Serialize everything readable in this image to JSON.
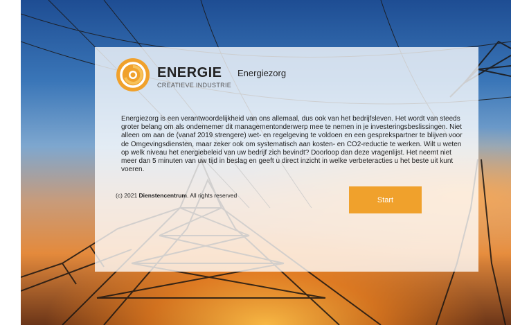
{
  "brand": {
    "name": "ENERGIE",
    "subtitle": "CREATIEVE INDUSTRIE",
    "icon": "energy-swirl-icon",
    "accent": "#f0a12c"
  },
  "header": {
    "title": "Energiezorg"
  },
  "intro": {
    "text": "Energiezorg is een verantwoordelijkheid van ons allemaal, dus ook van het bedrijfsleven. Het wordt van steeds groter belang om als ondernemer dit managementonderwerp mee te nemen in je investeringsbeslissingen. Niet alleen om aan de (vanaf 2019 strengere) wet- en regelgeving te voldoen en een gesprekspartner te blijven voor de Omgevingsdiensten, maar zeker ook om systematisch aan kosten- en CO2-reductie te werken. Wilt u weten op welk niveau het energiebeleid van uw bedrijf zich bevindt? Doorloop dan deze vragenlijst. Het neemt niet meer dan 5 minuten van uw tijd in beslag en geeft u direct inzicht in welke verbeteracties u het beste uit kunt voeren."
  },
  "footer": {
    "copyright_prefix": "(c) 2021 ",
    "copyright_org": "Dienstencentrum",
    "copyright_suffix": ". All rights reserved"
  },
  "actions": {
    "start_label": "Start"
  }
}
